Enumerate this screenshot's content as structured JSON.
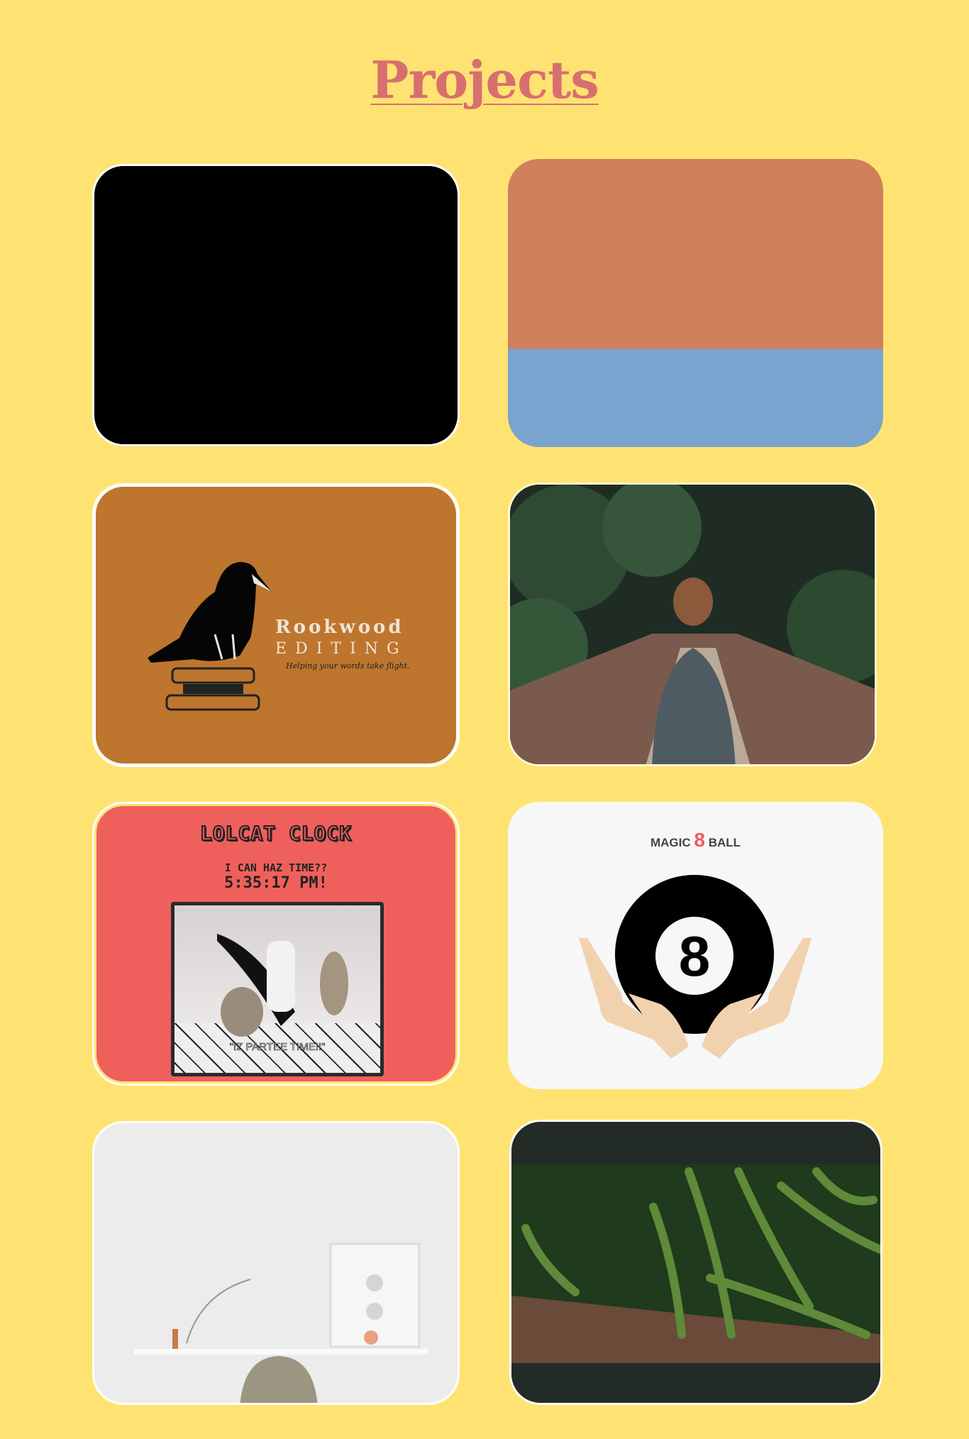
{
  "header": {
    "title": "Projects"
  },
  "projects": [
    {
      "name": "black-project"
    },
    {
      "name": "color-block-project",
      "colors": [
        "#D0805A",
        "#78A4CF"
      ]
    },
    {
      "name": "rookwood-editing",
      "brand": "Rookwood",
      "subtitle": "EDITING",
      "tagline": "Helping your words take flight."
    },
    {
      "name": "woman-on-bridge-photo"
    },
    {
      "name": "lolcat-clock",
      "title": "LOLCAT CLOCK",
      "question": "I CAN HAZ TIME??",
      "time": "5:35:17 PM!",
      "caption": "\"IZ PARTEE TIME!!\""
    },
    {
      "name": "magic-8-ball",
      "title_left": "MAGIC",
      "title_num": "8",
      "title_right": "BALL",
      "ball_number": "8"
    },
    {
      "name": "desk-workspace-photo"
    },
    {
      "name": "green-beans-photo"
    }
  ],
  "colors": {
    "background": "#FFE372",
    "title": "#D86F6F"
  }
}
